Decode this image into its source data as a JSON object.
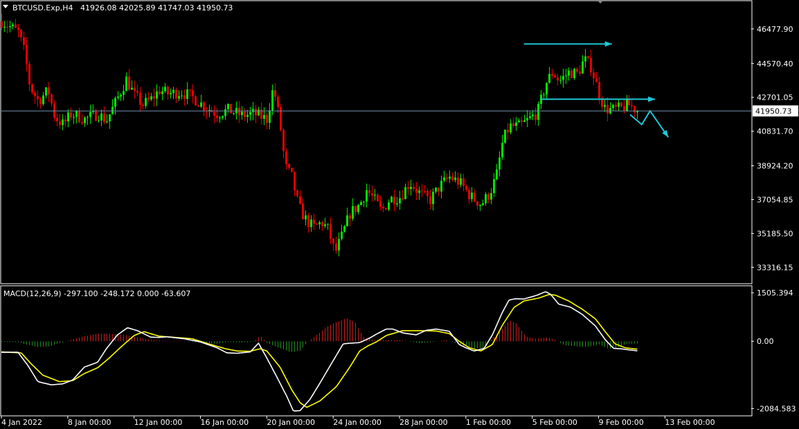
{
  "price_header": {
    "symbol_label": "BTCUSD.Exp,H4",
    "ohlc_values": "41926.08 42025.89 41747.03 41950.73"
  },
  "macd_header": {
    "label": "MACD(12,26,9) -297.100 -248.172 0.000 -63.607"
  },
  "colors": {
    "background": "#000000",
    "frame": "#ffffff",
    "bull_candle": "#00e600",
    "bear_candle": "#e60000",
    "current_price_line": "#6e8ba6",
    "arrow": "#1ec8d8",
    "macd_line": "#ffffff",
    "signal_line": "#ffff00",
    "hist_positive": "#c81e1e",
    "hist_negative": "#1e8c1e"
  },
  "chart_data": [
    {
      "type": "candlestick",
      "title": "BTCUSD.Exp,H4",
      "y_axis": {
        "ticks": [
          "46477.90",
          "44570.40",
          "42701.05",
          "40831.70",
          "38924.20",
          "37054.85",
          "35185.50",
          "33316.15"
        ],
        "tick_values": [
          46477.9,
          44570.4,
          42701.05,
          40831.7,
          38924.2,
          37054.85,
          35185.5,
          33316.15
        ],
        "range": [
          32450,
          48000
        ]
      },
      "current_price": {
        "value": 41950.73,
        "label": "41950.73"
      },
      "x_axis": {
        "ticks": [
          "4 Jan 2022",
          "8 Jan 00:00",
          "12 Jan 00:00",
          "16 Jan 00:00",
          "20 Jan 00:00",
          "24 Jan 00:00",
          "28 Jan 00:00",
          "1 Feb 00:00",
          "5 Feb 00:00",
          "9 Feb 00:00",
          "13 Feb 00:00"
        ],
        "tick_days": [
          0,
          4,
          8,
          12,
          16,
          20,
          24,
          28,
          32,
          36,
          40
        ],
        "range_days": [
          0,
          45.2
        ]
      },
      "close_path": [
        [
          0,
          46900
        ],
        [
          0.5,
          46600
        ],
        [
          1,
          46300
        ],
        [
          1.4,
          45100
        ],
        [
          1.7,
          43300
        ],
        [
          2.2,
          42500
        ],
        [
          2.8,
          43100
        ],
        [
          3.2,
          41600
        ],
        [
          3.7,
          41200
        ],
        [
          4.2,
          41800
        ],
        [
          5,
          41500
        ],
        [
          5.8,
          41800
        ],
        [
          6.3,
          41400
        ],
        [
          7,
          42700
        ],
        [
          7.5,
          43700
        ],
        [
          8,
          42800
        ],
        [
          8.5,
          42300
        ],
        [
          9,
          42600
        ],
        [
          9.5,
          43100
        ],
        [
          10,
          42900
        ],
        [
          10.8,
          43000
        ],
        [
          11.5,
          42700
        ],
        [
          12.2,
          42200
        ],
        [
          13,
          41800
        ],
        [
          13.7,
          42000
        ],
        [
          14.5,
          41700
        ],
        [
          15.2,
          41800
        ],
        [
          16,
          41500
        ],
        [
          16.4,
          43300
        ],
        [
          16.8,
          41200
        ],
        [
          17.1,
          38900
        ],
        [
          17.5,
          38300
        ],
        [
          17.9,
          36700
        ],
        [
          18.3,
          36000
        ],
        [
          18.8,
          35500
        ],
        [
          19.3,
          35800
        ],
        [
          19.7,
          35400
        ],
        [
          20.1,
          34100
        ],
        [
          20.5,
          35000
        ],
        [
          21,
          36300
        ],
        [
          21.6,
          36800
        ],
        [
          22,
          37600
        ],
        [
          22.5,
          37000
        ],
        [
          22.9,
          36400
        ],
        [
          23.4,
          37100
        ],
        [
          24,
          37200
        ],
        [
          24.6,
          38000
        ],
        [
          25.2,
          37400
        ],
        [
          25.8,
          37000
        ],
        [
          26.4,
          37800
        ],
        [
          27,
          38300
        ],
        [
          27.6,
          38000
        ],
        [
          28.3,
          37200
        ],
        [
          28.9,
          36800
        ],
        [
          29.4,
          37400
        ],
        [
          29.8,
          38300
        ],
        [
          30.2,
          40300
        ],
        [
          30.6,
          41100
        ],
        [
          31.2,
          41100
        ],
        [
          31.8,
          41500
        ],
        [
          32.3,
          41900
        ],
        [
          32.8,
          43500
        ],
        [
          33.2,
          44100
        ],
        [
          33.6,
          43600
        ],
        [
          34.2,
          44100
        ],
        [
          34.7,
          44000
        ],
        [
          35.1,
          44800
        ],
        [
          35.5,
          44400
        ],
        [
          35.9,
          43200
        ],
        [
          36.3,
          42100
        ],
        [
          36.8,
          42000
        ],
        [
          37.3,
          42100
        ],
        [
          37.8,
          42300
        ],
        [
          38.4,
          41950
        ]
      ],
      "annotations": [
        {
          "type": "arrow",
          "points": [
            [
              31.5,
              45650
            ],
            [
              36.8,
              45650
            ]
          ]
        },
        {
          "type": "arrow",
          "points": [
            [
              32.5,
              42600
            ],
            [
              39.4,
              42600
            ]
          ]
        },
        {
          "type": "arrow",
          "points": [
            [
              37.9,
              41750
            ],
            [
              38.6,
              41200
            ],
            [
              39.1,
              41950
            ],
            [
              40.2,
              40500
            ]
          ]
        }
      ]
    },
    {
      "type": "macd",
      "title": "MACD(12,26,9) -297.100 -248.172 0.000 -63.607",
      "parameters": [
        12,
        26,
        9
      ],
      "values": {
        "macd": -297.1,
        "signal": -248.172,
        "zero": 0.0,
        "histogram": -63.607
      },
      "y_axis": {
        "ticks": [
          "1505.394",
          "0.00",
          "-2084.583"
        ],
        "tick_values": [
          1505.394,
          0,
          -2084.583
        ],
        "range": [
          -2290,
          1700
        ]
      },
      "macd_line": [
        [
          0,
          -340
        ],
        [
          1,
          -340
        ],
        [
          1.6,
          -750
        ],
        [
          2.2,
          -1250
        ],
        [
          3,
          -1350
        ],
        [
          3.7,
          -1320
        ],
        [
          4.3,
          -1200
        ],
        [
          5,
          -800
        ],
        [
          5.8,
          -650
        ],
        [
          6.3,
          -250
        ],
        [
          7,
          200
        ],
        [
          7.6,
          420
        ],
        [
          8.2,
          330
        ],
        [
          9,
          130
        ],
        [
          9.5,
          120
        ],
        [
          10,
          140
        ],
        [
          11,
          80
        ],
        [
          12,
          -20
        ],
        [
          13,
          -200
        ],
        [
          13.6,
          -360
        ],
        [
          14.2,
          -370
        ],
        [
          15,
          -330
        ],
        [
          15.5,
          -60
        ],
        [
          16,
          -520
        ],
        [
          16.6,
          -1100
        ],
        [
          17.2,
          -1700
        ],
        [
          17.6,
          -2160
        ],
        [
          18,
          -2150
        ],
        [
          18.6,
          -1800
        ],
        [
          19.2,
          -1300
        ],
        [
          20,
          -600
        ],
        [
          20.6,
          -80
        ],
        [
          21,
          -60
        ],
        [
          21.6,
          -40
        ],
        [
          22.2,
          100
        ],
        [
          22.6,
          220
        ],
        [
          23.2,
          380
        ],
        [
          23.6,
          380
        ],
        [
          24.2,
          260
        ],
        [
          25,
          200
        ],
        [
          25.6,
          340
        ],
        [
          26.2,
          380
        ],
        [
          27,
          310
        ],
        [
          27.6,
          -100
        ],
        [
          28,
          -200
        ],
        [
          28.5,
          -300
        ],
        [
          29.1,
          -220
        ],
        [
          29.6,
          200
        ],
        [
          30.2,
          900
        ],
        [
          30.6,
          1280
        ],
        [
          31,
          1320
        ],
        [
          31.5,
          1310
        ],
        [
          32.3,
          1430
        ],
        [
          32.8,
          1540
        ],
        [
          33.1,
          1460
        ],
        [
          33.6,
          1150
        ],
        [
          34.3,
          1060
        ],
        [
          35,
          840
        ],
        [
          35.8,
          480
        ],
        [
          36.4,
          50
        ],
        [
          36.9,
          -220
        ],
        [
          37.3,
          -230
        ],
        [
          38.4,
          -300
        ]
      ],
      "signal_line": [
        [
          0,
          -330
        ],
        [
          1.2,
          -360
        ],
        [
          1.8,
          -700
        ],
        [
          2.5,
          -1050
        ],
        [
          3.5,
          -1250
        ],
        [
          4.3,
          -1220
        ],
        [
          5,
          -1000
        ],
        [
          5.8,
          -820
        ],
        [
          6.5,
          -520
        ],
        [
          7.2,
          -180
        ],
        [
          8,
          180
        ],
        [
          8.6,
          300
        ],
        [
          9.5,
          160
        ],
        [
          10.5,
          120
        ],
        [
          11.5,
          80
        ],
        [
          12.5,
          -80
        ],
        [
          13.5,
          -230
        ],
        [
          14.2,
          -300
        ],
        [
          15,
          -310
        ],
        [
          15.6,
          -230
        ],
        [
          16,
          -300
        ],
        [
          16.8,
          -800
        ],
        [
          17.5,
          -1500
        ],
        [
          18,
          -1900
        ],
        [
          18.4,
          -2050
        ],
        [
          19.2,
          -1850
        ],
        [
          20.2,
          -1400
        ],
        [
          21,
          -800
        ],
        [
          21.6,
          -300
        ],
        [
          22.1,
          -140
        ],
        [
          22.6,
          -20
        ],
        [
          23.2,
          180
        ],
        [
          24.2,
          330
        ],
        [
          25.2,
          330
        ],
        [
          26.2,
          320
        ],
        [
          27,
          240
        ],
        [
          27.6,
          0
        ],
        [
          28.2,
          -200
        ],
        [
          28.9,
          -300
        ],
        [
          29.6,
          -100
        ],
        [
          30.2,
          500
        ],
        [
          30.9,
          1050
        ],
        [
          31.5,
          1250
        ],
        [
          32.4,
          1340
        ],
        [
          33,
          1450
        ],
        [
          33.4,
          1430
        ],
        [
          34.2,
          1250
        ],
        [
          35,
          1000
        ],
        [
          35.8,
          700
        ],
        [
          36.4,
          300
        ],
        [
          37,
          -80
        ],
        [
          37.6,
          -200
        ],
        [
          38.4,
          -248
        ]
      ],
      "histogram": [
        [
          0,
          -20
        ],
        [
          1,
          -30
        ],
        [
          1.6,
          -120
        ],
        [
          2.2,
          -180
        ],
        [
          2.8,
          -160
        ],
        [
          3.5,
          -60
        ],
        [
          4.3,
          60
        ],
        [
          5,
          160
        ],
        [
          5.8,
          240
        ],
        [
          6.6,
          230
        ],
        [
          7.4,
          200
        ],
        [
          8.2,
          120
        ],
        [
          9,
          40
        ],
        [
          10,
          10
        ],
        [
          11,
          10
        ],
        [
          12,
          -40
        ],
        [
          13,
          -80
        ],
        [
          13.7,
          -20
        ],
        [
          14.4,
          -40
        ],
        [
          15.2,
          -20
        ],
        [
          15.6,
          180
        ],
        [
          16,
          -50
        ],
        [
          16.6,
          -180
        ],
        [
          17.4,
          -330
        ],
        [
          18,
          -300
        ],
        [
          18.4,
          -50
        ],
        [
          19,
          200
        ],
        [
          19.6,
          450
        ],
        [
          20.2,
          600
        ],
        [
          20.8,
          720
        ],
        [
          21.3,
          600
        ],
        [
          21.8,
          130
        ],
        [
          22.4,
          40
        ],
        [
          23.2,
          40
        ],
        [
          24,
          40
        ],
        [
          24.7,
          -20
        ],
        [
          25.2,
          -60
        ],
        [
          26,
          -20
        ],
        [
          26.8,
          40
        ],
        [
          27.4,
          -60
        ],
        [
          27.9,
          -150
        ],
        [
          28.4,
          -250
        ],
        [
          29,
          -200
        ],
        [
          29.6,
          100
        ],
        [
          30.2,
          400
        ],
        [
          30.6,
          650
        ],
        [
          31,
          560
        ],
        [
          31.6,
          140
        ],
        [
          32.2,
          80
        ],
        [
          32.8,
          120
        ],
        [
          33.3,
          60
        ],
        [
          33.9,
          -120
        ],
        [
          34.5,
          -150
        ],
        [
          35.2,
          -180
        ],
        [
          36,
          -100
        ],
        [
          36.6,
          -240
        ],
        [
          37.1,
          -200
        ],
        [
          37.6,
          -80
        ],
        [
          38.4,
          -64
        ]
      ]
    }
  ]
}
